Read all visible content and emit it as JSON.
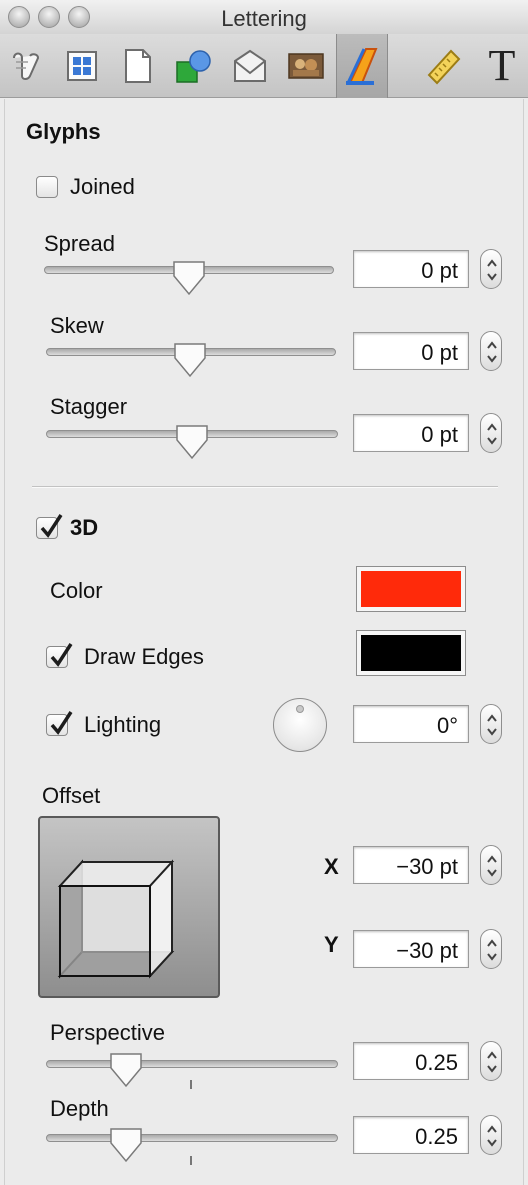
{
  "window": {
    "title": "Lettering"
  },
  "toolbar": {
    "tools": [
      {
        "icon": "scroll-tool-icon"
      },
      {
        "icon": "layout-grid-icon"
      },
      {
        "icon": "page-icon"
      },
      {
        "icon": "shapes-icon"
      },
      {
        "icon": "envelope-icon"
      },
      {
        "icon": "image-icon"
      },
      {
        "icon": "lettering-icon",
        "active": true
      },
      {
        "icon": "ruler-icon"
      },
      {
        "icon": "text-icon",
        "glyph": "T"
      }
    ]
  },
  "glyphs": {
    "heading": "Glyphs",
    "joined": {
      "label": "Joined",
      "checked": false
    },
    "spread": {
      "label": "Spread",
      "value": "0 pt",
      "slider": 0.5
    },
    "skew": {
      "label": "Skew",
      "value": "0 pt",
      "slider": 0.5
    },
    "stagger": {
      "label": "Stagger",
      "value": "0 pt",
      "slider": 0.5
    }
  },
  "three_d": {
    "label": "3D",
    "checked": true,
    "color": {
      "label": "Color",
      "swatch": "#ff2a0a"
    },
    "draw_edges": {
      "label": "Draw Edges",
      "checked": true,
      "swatch": "#000000"
    },
    "lighting": {
      "label": "Lighting",
      "checked": true,
      "value": "0°"
    },
    "offset": {
      "label": "Offset",
      "x_label": "X",
      "x_value": "−30 pt",
      "y_label": "Y",
      "y_value": "−30 pt"
    },
    "perspective": {
      "label": "Perspective",
      "value": "0.25",
      "slider": 0.25
    },
    "depth": {
      "label": "Depth",
      "value": "0.25",
      "slider": 0.25
    }
  },
  "colors": {
    "accent_blue": "#2a6fd6",
    "lettering_orange": "#f4a11a"
  }
}
